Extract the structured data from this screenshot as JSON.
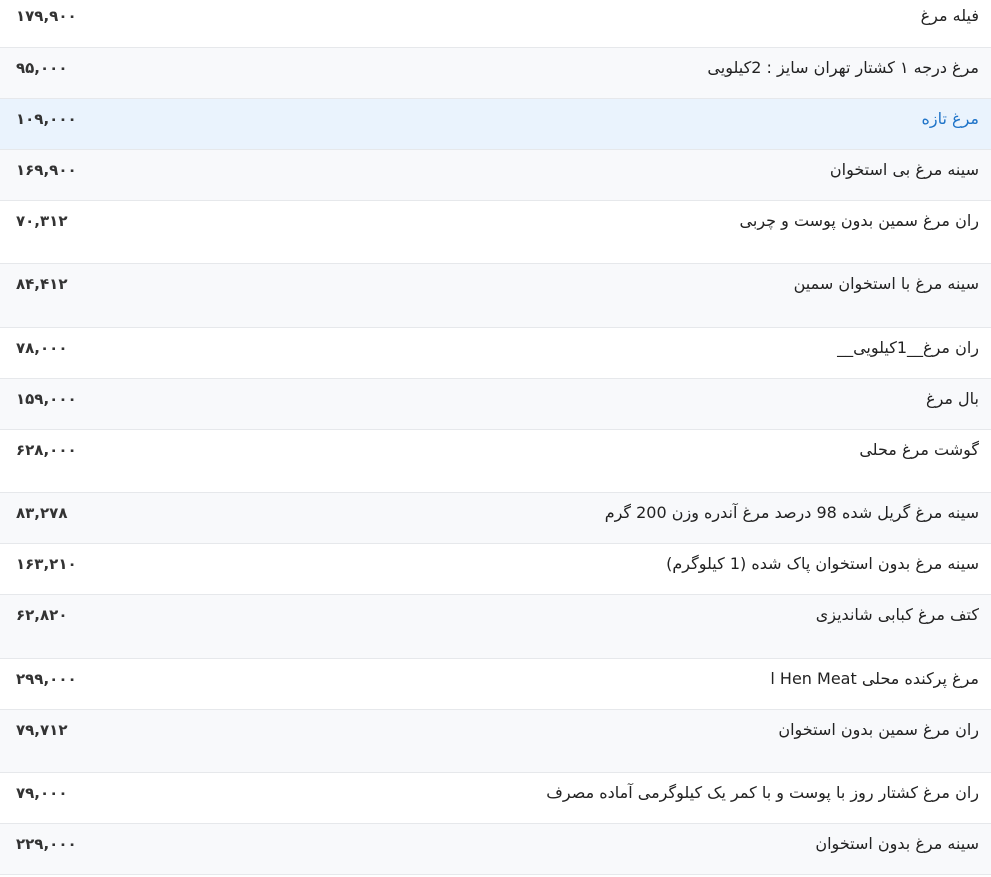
{
  "products": [
    {
      "name": "فیله مرغ",
      "price": "۱۷۹,۹۰۰"
    },
    {
      "name": "مرغ درجه ۱ کشتار تهران سایز : 2کیلویی",
      "price": "۹۵,۰۰۰"
    },
    {
      "name": "مرغ تازه",
      "price": "۱۰۹,۰۰۰"
    },
    {
      "name": "سینه مرغ بی استخوان",
      "price": "۱۶۹,۹۰۰"
    },
    {
      "name": "ران مرغ سمین بدون پوست و چربی",
      "price": "۷۰,۳۱۲"
    },
    {
      "name": "سینه مرغ با استخوان سمین",
      "price": "۸۴,۴۱۲"
    },
    {
      "name": "ران مرغ__1کیلویی__",
      "price": "۷۸,۰۰۰"
    },
    {
      "name": "بال مرغ",
      "price": "۱۵۹,۰۰۰"
    },
    {
      "name": "گوشت مرغ محلی",
      "price": "۶۲۸,۰۰۰"
    },
    {
      "name": "سینه مرغ گریل شده 98 درصد مرغ آندره وزن 200 گرم",
      "price": "۸۳,۲۷۸"
    },
    {
      "name": "سینه مرغ بدون استخوان پاک شده (1 کیلوگرم)",
      "price": "۱۶۳,۲۱۰"
    },
    {
      "name": "کتف مرغ کبابی شاندیزی",
      "price": "۶۲,۸۲۰"
    },
    {
      "name": "مرغ پرکنده محلی Hen Meat ا",
      "price": "۲۹۹,۰۰۰"
    },
    {
      "name": "ران مرغ سمین بدون استخوان",
      "price": "۷۹,۷۱۲"
    },
    {
      "name": "ران مرغ کشتار روز با پوست و با کمر یک کیلوگرمی آماده مصرف",
      "price": "۷۹,۰۰۰"
    },
    {
      "name": "سینه مرغ بدون استخوان",
      "price": "۲۲۹,۰۰۰"
    }
  ]
}
